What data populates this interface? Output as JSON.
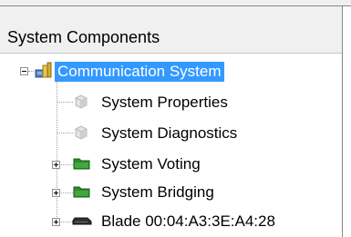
{
  "panel": {
    "title": "System Components"
  },
  "tree": {
    "root": {
      "label": "Communication System",
      "icon": "communication-system-icon",
      "expanded": true,
      "selected": true
    },
    "children": [
      {
        "label": "System Properties",
        "icon": "properties-icon",
        "expandable": false
      },
      {
        "label": "System Diagnostics",
        "icon": "diagnostics-icon",
        "expandable": false
      },
      {
        "label": "System Voting",
        "icon": "folder-icon",
        "expandable": true
      },
      {
        "label": "System Bridging",
        "icon": "folder-icon",
        "expandable": true
      },
      {
        "label": "Blade 00:04:A3:3E:A4:28",
        "icon": "blade-icon",
        "expandable": true
      }
    ]
  },
  "colors": {
    "selection": "#3399ff",
    "header_bg": "#f0f0f0",
    "folder_green": "#2e8b2e",
    "tree_line": "#a0a0a0"
  }
}
